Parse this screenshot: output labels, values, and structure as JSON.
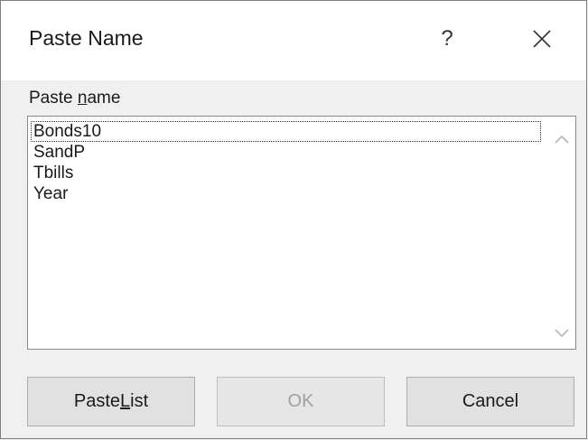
{
  "dialog": {
    "title": "Paste Name",
    "help_glyph": "?",
    "close_icon": "close-icon"
  },
  "paste_name": {
    "label_prefix": "Paste ",
    "label_access": "n",
    "label_rest": "ame",
    "items": [
      "Bonds10",
      "SandP",
      "Tbills",
      "Year"
    ],
    "focused_index": 0
  },
  "buttons": {
    "paste_list_prefix": "Paste ",
    "paste_list_access": "L",
    "paste_list_rest": "ist",
    "ok": "OK",
    "cancel": "Cancel"
  }
}
